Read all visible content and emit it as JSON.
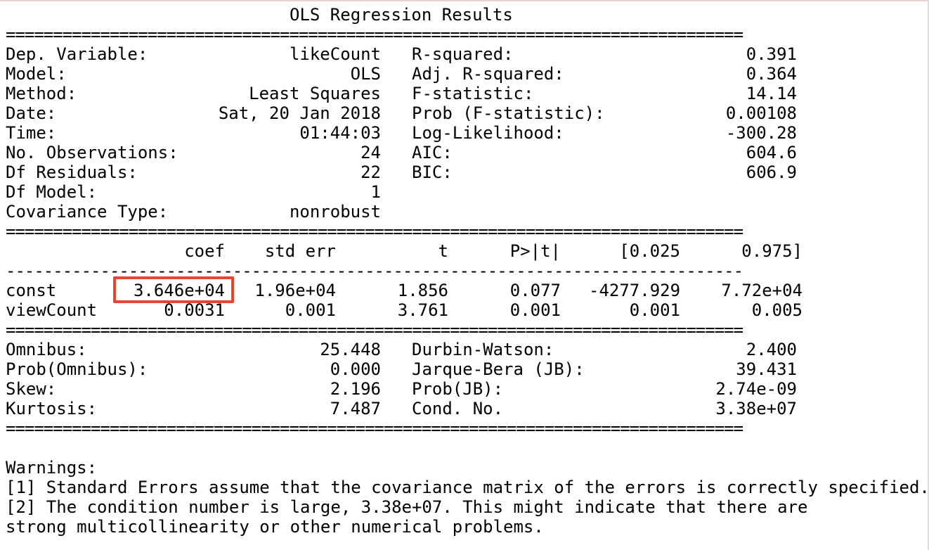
{
  "title": "OLS Regression Results",
  "header_left": [
    {
      "label": "Dep. Variable:",
      "value": "likeCount"
    },
    {
      "label": "Model:",
      "value": "OLS"
    },
    {
      "label": "Method:",
      "value": "Least Squares"
    },
    {
      "label": "Date:",
      "value": "Sat, 20 Jan 2018"
    },
    {
      "label": "Time:",
      "value": "01:44:03"
    },
    {
      "label": "No. Observations:",
      "value": "24"
    },
    {
      "label": "Df Residuals:",
      "value": "22"
    },
    {
      "label": "Df Model:",
      "value": "1"
    },
    {
      "label": "Covariance Type:",
      "value": "nonrobust"
    }
  ],
  "header_right": [
    {
      "label": "R-squared:",
      "value": "0.391"
    },
    {
      "label": "Adj. R-squared:",
      "value": "0.364"
    },
    {
      "label": "F-statistic:",
      "value": "14.14"
    },
    {
      "label": "Prob (F-statistic):",
      "value": "0.00108"
    },
    {
      "label": "Log-Likelihood:",
      "value": "-300.28"
    },
    {
      "label": "AIC:",
      "value": "604.6"
    },
    {
      "label": "BIC:",
      "value": "606.9"
    }
  ],
  "coef_table": {
    "columns": [
      "coef",
      "std err",
      "t",
      "P>|t|",
      "[0.025",
      "0.975]"
    ],
    "rows": [
      {
        "name": "const",
        "values": [
          "3.646e+04",
          "1.96e+04",
          "1.856",
          "0.077",
          "-4277.929",
          "7.72e+04"
        ]
      },
      {
        "name": "viewCount",
        "values": [
          "0.0031",
          "0.001",
          "3.761",
          "0.001",
          "0.001",
          "0.005"
        ]
      }
    ]
  },
  "footer_left": [
    {
      "label": "Omnibus:",
      "value": "25.448"
    },
    {
      "label": "Prob(Omnibus):",
      "value": "0.000"
    },
    {
      "label": "Skew:",
      "value": "2.196"
    },
    {
      "label": "Kurtosis:",
      "value": "7.487"
    }
  ],
  "footer_right": [
    {
      "label": "Durbin-Watson:",
      "value": "2.400"
    },
    {
      "label": "Jarque-Bera (JB):",
      "value": "39.431"
    },
    {
      "label": "Prob(JB):",
      "value": "2.74e-09"
    },
    {
      "label": "Cond. No.",
      "value": "3.38e+07"
    }
  ],
  "warnings": {
    "heading": "Warnings:",
    "lines": [
      "[1] Standard Errors assume that the covariance matrix of the errors is correctly specified.",
      "[2] The condition number is large, 3.38e+07. This might indicate that there are",
      "strong multicollinearity or other numerical problems."
    ]
  },
  "separators": {
    "double": "==============================================================================",
    "single": "------------------------------------------------------------------------------"
  },
  "colors": {
    "highlight": "#e8452f",
    "text": "#000000",
    "background": "#ffffff"
  }
}
